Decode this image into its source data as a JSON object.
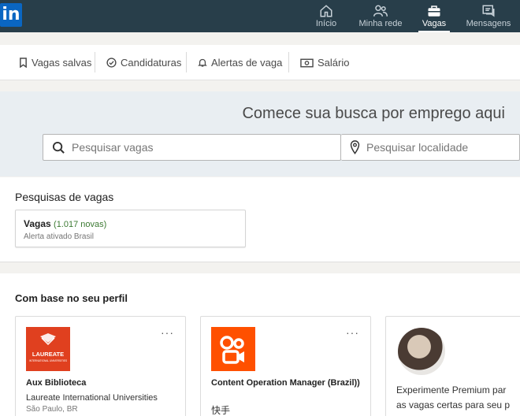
{
  "nav": {
    "logo_text": "in",
    "items": [
      {
        "label": "Início",
        "icon": "home-icon"
      },
      {
        "label": "Minha rede",
        "icon": "network-icon"
      },
      {
        "label": "Vagas",
        "icon": "briefcase-icon",
        "active": true
      },
      {
        "label": "Mensagens",
        "icon": "messages-icon"
      }
    ]
  },
  "subnav": {
    "items": [
      {
        "label": "Vagas salvas",
        "icon": "bookmark-icon"
      },
      {
        "label": "Candidaturas",
        "icon": "check-circle-icon"
      },
      {
        "label": "Alertas de vaga",
        "icon": "bell-icon"
      },
      {
        "label": "Salário",
        "icon": "money-icon"
      }
    ]
  },
  "search": {
    "title": "Comece sua busca por emprego aqui",
    "jobs_placeholder": "Pesquisar vagas",
    "location_placeholder": "Pesquisar localidade"
  },
  "saved_searches": {
    "title": "Pesquisas de vagas",
    "alert": {
      "name": "Vagas",
      "new_count": "(1.017 novas)",
      "subtitle": "Alerta ativado Brasil"
    }
  },
  "recommendations": {
    "title": "Com base no seu perfil",
    "jobs": [
      {
        "title": "Aux Biblioteca",
        "company": "Laureate International Universities",
        "location": "São Paulo, BR",
        "logo_text": "LAUREATE",
        "logo_subtext": "INTERNATIONAL UNIVERSITIES",
        "logo_color": "#e0401f"
      },
      {
        "title": "Content Operation Manager (Brazil))",
        "company": "快手",
        "location": "",
        "logo_color": "#ff5000"
      }
    ],
    "premium": {
      "line1": "Experimente Premium par",
      "line2": "as vagas certas para seu p"
    }
  },
  "colors": {
    "nav_bg": "#283e4a",
    "brand_blue": "#0a66c2",
    "accent_green": "#3c7a32"
  }
}
